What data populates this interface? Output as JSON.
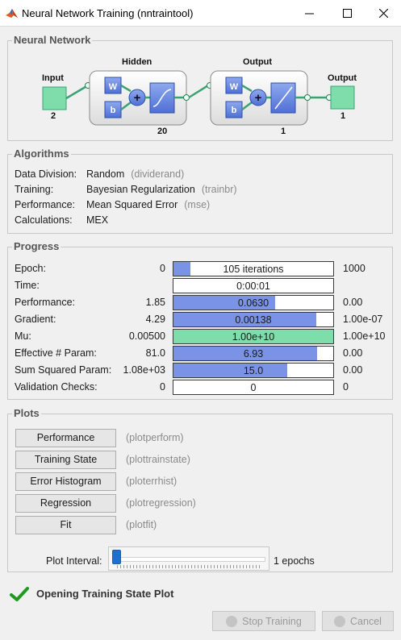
{
  "window": {
    "title": "Neural Network Training (nntraintool)"
  },
  "network": {
    "section_title": "Neural Network",
    "input_label": "Input",
    "input_size": "2",
    "hidden_label": "Hidden",
    "hidden_size": "20",
    "output_layer_label": "Output",
    "output_layer_size": "1",
    "output_label": "Output",
    "output_size": "1",
    "weight_symbol": "W",
    "bias_symbol": "b",
    "sum_symbol": "+"
  },
  "algorithms": {
    "section_title": "Algorithms",
    "rows": [
      {
        "label": "Data Division:",
        "value": "Random",
        "fn": "(dividerand)"
      },
      {
        "label": "Training:",
        "value": "Bayesian Regularization",
        "fn": "(trainbr)"
      },
      {
        "label": "Performance:",
        "value": "Mean Squared Error",
        "fn": "(mse)"
      },
      {
        "label": "Calculations:",
        "value": "MEX",
        "fn": ""
      }
    ]
  },
  "progress": {
    "section_title": "Progress",
    "rows": [
      {
        "label": "Epoch:",
        "start": "0",
        "bar_text": "105 iterations",
        "fill": 0.105,
        "end": "1000",
        "color": "#7a93e6"
      },
      {
        "label": "Time:",
        "start": "",
        "bar_text": "0:00:01",
        "fill": 0,
        "end": "",
        "color": "#7a93e6"
      },
      {
        "label": "Performance:",
        "start": "1.85",
        "bar_text": "0.0630",
        "fill": 0.635,
        "end": "0.00",
        "color": "#7a93e6"
      },
      {
        "label": "Gradient:",
        "start": "4.29",
        "bar_text": "0.00138",
        "fill": 0.895,
        "end": "1.00e-07",
        "color": "#7a93e6"
      },
      {
        "label": "Mu:",
        "start": "0.00500",
        "bar_text": "1.00e+10",
        "fill": 1.0,
        "end": "1.00e+10",
        "color": "#7fdcab"
      },
      {
        "label": "Effective # Param:",
        "start": "81.0",
        "bar_text": "6.93",
        "fill": 0.9,
        "end": "0.00",
        "color": "#7a93e6"
      },
      {
        "label": "Sum Squared Param:",
        "start": "1.08e+03",
        "bar_text": "15.0",
        "fill": 0.71,
        "end": "0.00",
        "color": "#7a93e6"
      },
      {
        "label": "Validation Checks:",
        "start": "0",
        "bar_text": "0",
        "fill": 0,
        "end": "0",
        "color": "#7a93e6"
      }
    ]
  },
  "plots": {
    "section_title": "Plots",
    "buttons": [
      {
        "label": "Performance",
        "fn": "(plotperform)"
      },
      {
        "label": "Training State",
        "fn": "(plottrainstate)"
      },
      {
        "label": "Error Histogram",
        "fn": "(ploterrhist)"
      },
      {
        "label": "Regression",
        "fn": "(plotregression)"
      },
      {
        "label": "Fit",
        "fn": "(plotfit)"
      }
    ],
    "interval_label": "Plot Interval:",
    "interval_value": "1 epochs",
    "interval_level": 0
  },
  "status": {
    "text": "Opening Training State Plot",
    "icon": "check-icon",
    "icon_color": "#1f9a1f"
  },
  "footer": {
    "stop_label": "Stop Training",
    "cancel_label": "Cancel"
  }
}
